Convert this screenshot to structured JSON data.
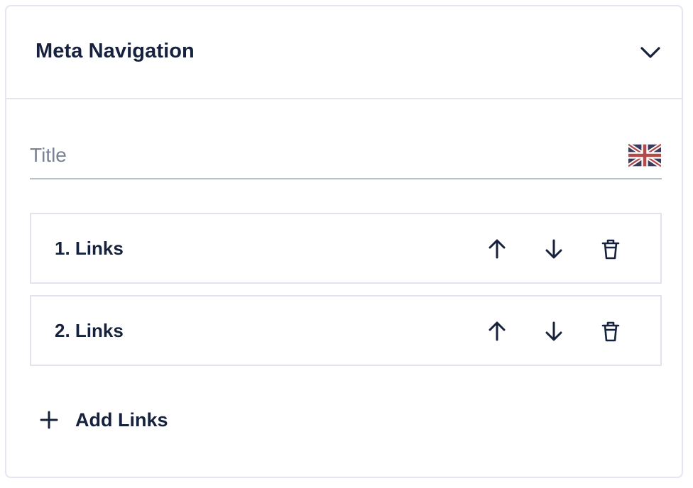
{
  "section": {
    "title": "Meta Navigation",
    "collapse_icon": "chevron-down-icon"
  },
  "title_field": {
    "placeholder": "Title",
    "value": "",
    "language_icon": "uk-flag-icon"
  },
  "links": {
    "items": [
      {
        "label": "1. Links"
      },
      {
        "label": "2. Links"
      }
    ],
    "item_action_icons": [
      "arrow-up-icon",
      "arrow-down-icon",
      "trash-icon"
    ],
    "add_label": "Add Links",
    "add_icon": "plus-icon"
  },
  "colors": {
    "text": "#16213e",
    "border": "#e3e6ee",
    "placeholder": "#7a8394"
  }
}
